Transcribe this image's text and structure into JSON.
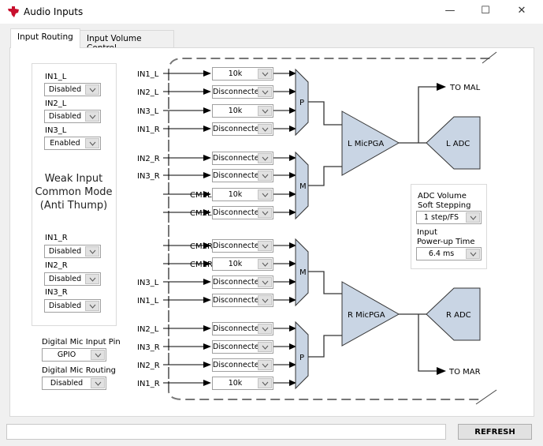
{
  "window": {
    "title": "Audio Inputs",
    "minimize": "—",
    "maximize": "☐",
    "close": "✕"
  },
  "tabs": [
    {
      "label": "Input Routing",
      "selected": true
    },
    {
      "label": "Input Volume Control",
      "selected": false
    }
  ],
  "weak_input": {
    "left": [
      {
        "label": "IN1_L",
        "value": "Disabled"
      },
      {
        "label": "IN2_L",
        "value": "Disabled"
      },
      {
        "label": "IN3_L",
        "value": "Enabled"
      }
    ],
    "title": [
      "Weak Input",
      "Common Mode",
      "(Anti Thump)"
    ],
    "right": [
      {
        "label": "IN1_R",
        "value": "Disabled"
      },
      {
        "label": "IN2_R",
        "value": "Disabled"
      },
      {
        "label": "IN3_R",
        "value": "Disabled"
      }
    ]
  },
  "digital_mic": {
    "pin_label": "Digital Mic Input Pin",
    "pin_value": "GPIO",
    "routing_label": "Digital Mic Routing",
    "routing_value": "Disabled"
  },
  "routing": [
    {
      "label": "IN1_L",
      "value": "10k"
    },
    {
      "label": "IN2_L",
      "value": "Disconnected"
    },
    {
      "label": "IN3_L",
      "value": "10k"
    },
    {
      "label": "IN1_R",
      "value": "Disconnected"
    },
    {
      "label": "IN2_R",
      "value": "Disconnected"
    },
    {
      "label": "IN3_R",
      "value": "Disconnected"
    },
    {
      "label": "CM1L",
      "value": "10k"
    },
    {
      "label": "CM2L",
      "value": "Disconnected"
    },
    {
      "label": "CM2R",
      "value": "Disconnected"
    },
    {
      "label": "CM1R",
      "value": "10k"
    },
    {
      "label": "IN3_L",
      "value": "Disconnected"
    },
    {
      "label": "IN1_L",
      "value": "Disconnected"
    },
    {
      "label": "IN2_L",
      "value": "Disconnected"
    },
    {
      "label": "IN3_R",
      "value": "Disconnected"
    },
    {
      "label": "IN2_R",
      "value": "Disconnected"
    },
    {
      "label": "IN1_R",
      "value": "10k"
    }
  ],
  "mux_labels": [
    "P",
    "M",
    "M",
    "P"
  ],
  "pga": {
    "left": "L MicPGA",
    "right": "R MicPGA"
  },
  "adc": {
    "left": "L ADC",
    "right": "R ADC"
  },
  "outputs": {
    "left": "TO MAL",
    "right": "TO MAR"
  },
  "adc_settings": {
    "soft_label1": "ADC Volume",
    "soft_label2": "Soft Stepping",
    "soft_value": "1 step/FS",
    "pu_label1": "Input",
    "pu_label2": "Power-up Time",
    "pu_value": "6.4 ms"
  },
  "footer": {
    "status": "",
    "refresh": "REFRESH"
  },
  "colors": {
    "block_fill": "#c9d5e4",
    "logo": "#c8102e"
  }
}
